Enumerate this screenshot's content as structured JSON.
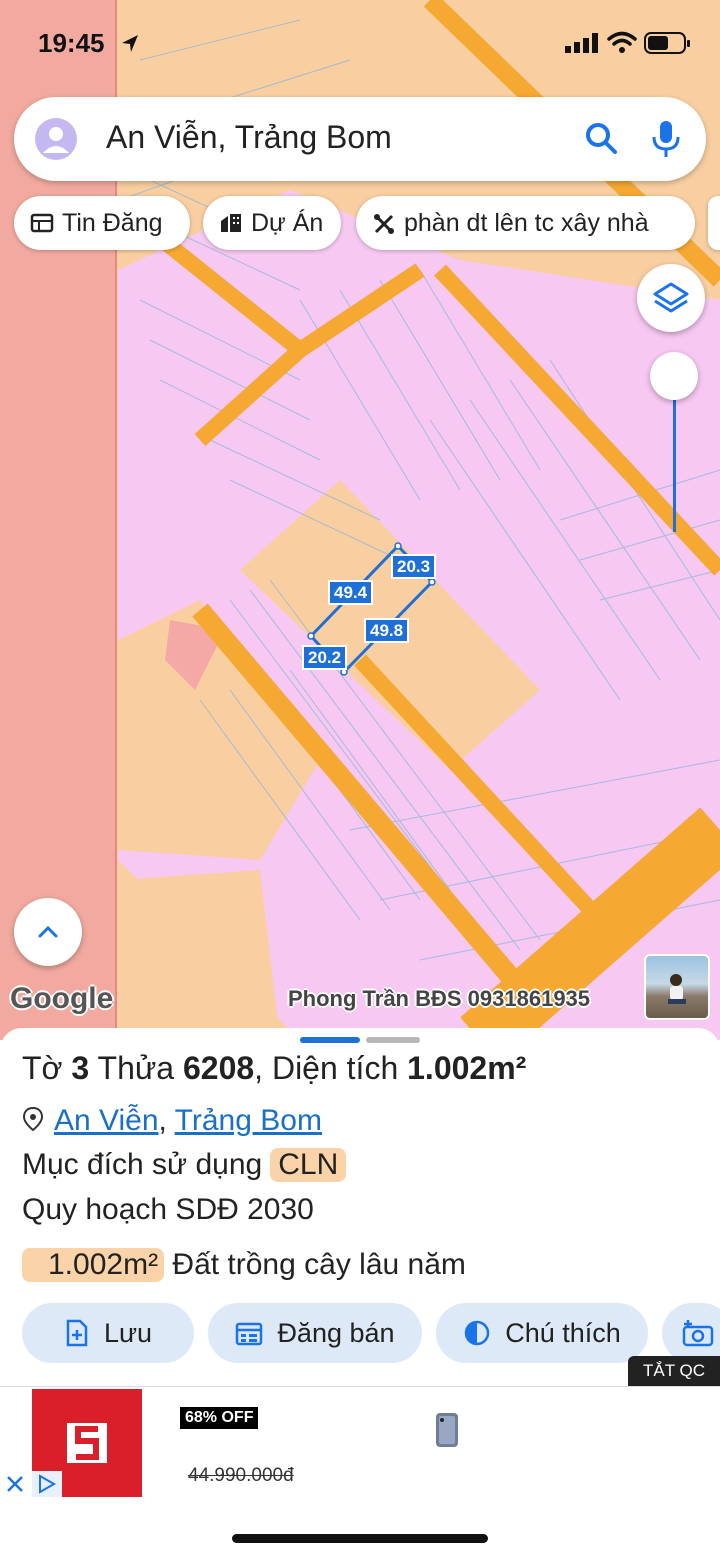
{
  "status_bar": {
    "time": "19:45"
  },
  "search": {
    "query": "An Viễn, Trảng Bom"
  },
  "chips": [
    {
      "label": "Tin Đăng",
      "icon": "listing-icon"
    },
    {
      "label": "Dự Án",
      "icon": "building-icon"
    },
    {
      "label": "phàn dt lên tc xây nhà",
      "icon": "tools-icon"
    }
  ],
  "map": {
    "google_logo": "Google",
    "watermark": "Phong Trần BĐS 0931861935",
    "dimensions": [
      "20.3",
      "49.4",
      "49.8",
      "20.2"
    ],
    "colors": {
      "residential": "#f7c8f2",
      "agricultural": "#f9cfa2",
      "road": "#f5a832",
      "boundary": "#f2aaa0",
      "measure": "#1e6fd6"
    }
  },
  "parcel": {
    "sheet_label": "Tờ",
    "sheet_number": "3",
    "plot_label": "Thửa",
    "plot_number": "6208",
    "area_label": "Diện tích",
    "area_value": "1.002m²",
    "location_1": "An Viễn",
    "location_2": "Trảng Bom",
    "purpose_label": "Mục đích sử dụng",
    "purpose_code": "CLN",
    "plan_label": "Quy hoạch SDĐ 2030",
    "plan_area": "1.002m²",
    "plan_desc": "Đất trồng cây lâu năm"
  },
  "actions": [
    {
      "label": "Lưu",
      "icon": "save-icon"
    },
    {
      "label": "Đăng bán",
      "icon": "calendar-icon"
    },
    {
      "label": "Chú thích",
      "icon": "contrast-icon"
    }
  ],
  "ad": {
    "hide_label": "TẮT QC",
    "discount": "68% OFF",
    "old_price": "44.990.000đ"
  }
}
